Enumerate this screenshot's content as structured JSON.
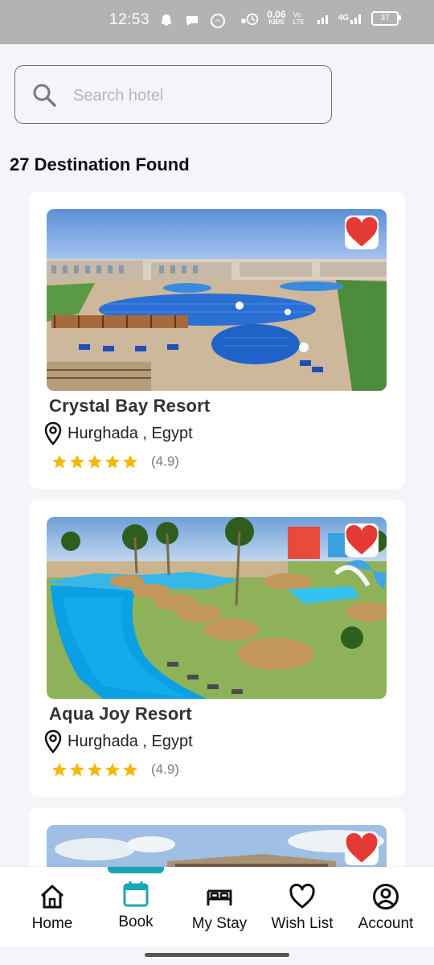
{
  "status_bar": {
    "time": "12:53",
    "speed_value": "0.06",
    "speed_unit": "KB/S",
    "volte": "Vo LTE",
    "network": "4G",
    "battery": "37"
  },
  "search": {
    "placeholder": "Search hotel",
    "value": ""
  },
  "results_count_text": "27 Destination Found",
  "hotels": [
    {
      "name": "Crystal Bay Resort",
      "location": "Hurghada , Egypt",
      "rating": "(4.9)",
      "stars": 5,
      "favorited": true
    },
    {
      "name": "Aqua Joy Resort",
      "location": "Hurghada , Egypt",
      "rating": "(4.9)",
      "stars": 5,
      "favorited": true
    },
    {
      "favorited": true
    }
  ],
  "bottom_nav": {
    "items": [
      {
        "label": "Home",
        "icon": "home-icon"
      },
      {
        "label": "Book",
        "icon": "calendar-icon",
        "active": true
      },
      {
        "label": "My Stay",
        "icon": "bed-icon"
      },
      {
        "label": "Wish List",
        "icon": "heart-icon"
      },
      {
        "label": "Account",
        "icon": "account-icon"
      }
    ]
  },
  "colors": {
    "accent": "#1aa6b7",
    "heart": "#e53935",
    "star": "#f5b800",
    "background": "#f5f4f8"
  }
}
